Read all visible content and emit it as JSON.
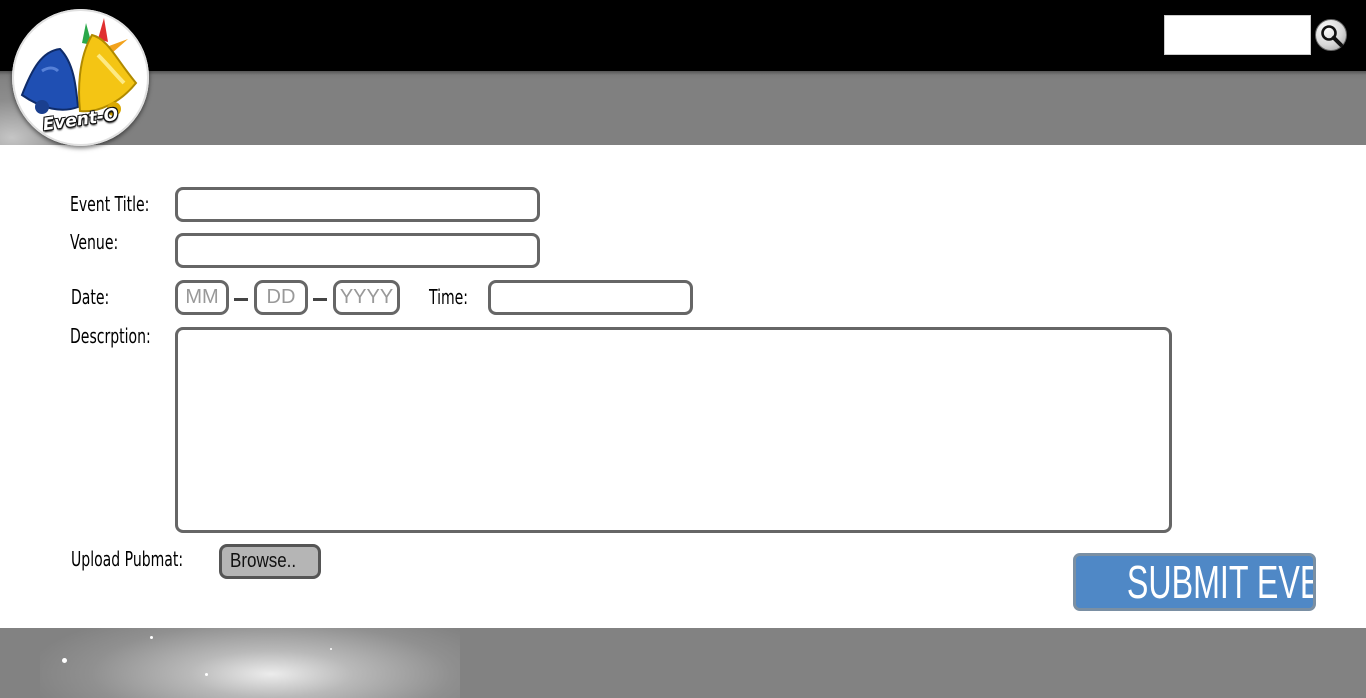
{
  "header": {
    "logo_text": "Event-O",
    "search": {
      "value": "",
      "placeholder": ""
    }
  },
  "form": {
    "event_title_label": "Event Title:",
    "venue_label": "Venue:",
    "date_label": "Date:",
    "date_mm_placeholder": "MM",
    "date_dd_placeholder": "DD",
    "date_yyyy_placeholder": "YYYY",
    "time_label": "Time:",
    "description_label": "Descrption:",
    "upload_label": "Upload Pubmat:",
    "browse_label": "Browse..",
    "submit_label": "SUBMIT EVENT"
  },
  "colors": {
    "header_black": "#000000",
    "header_grey": "#808080",
    "field_border": "#666666",
    "submit_blue": "#4f88c6",
    "footer_grey": "#828282"
  },
  "icons": {
    "search": "magnifier-icon",
    "logo": "bells-icon"
  }
}
